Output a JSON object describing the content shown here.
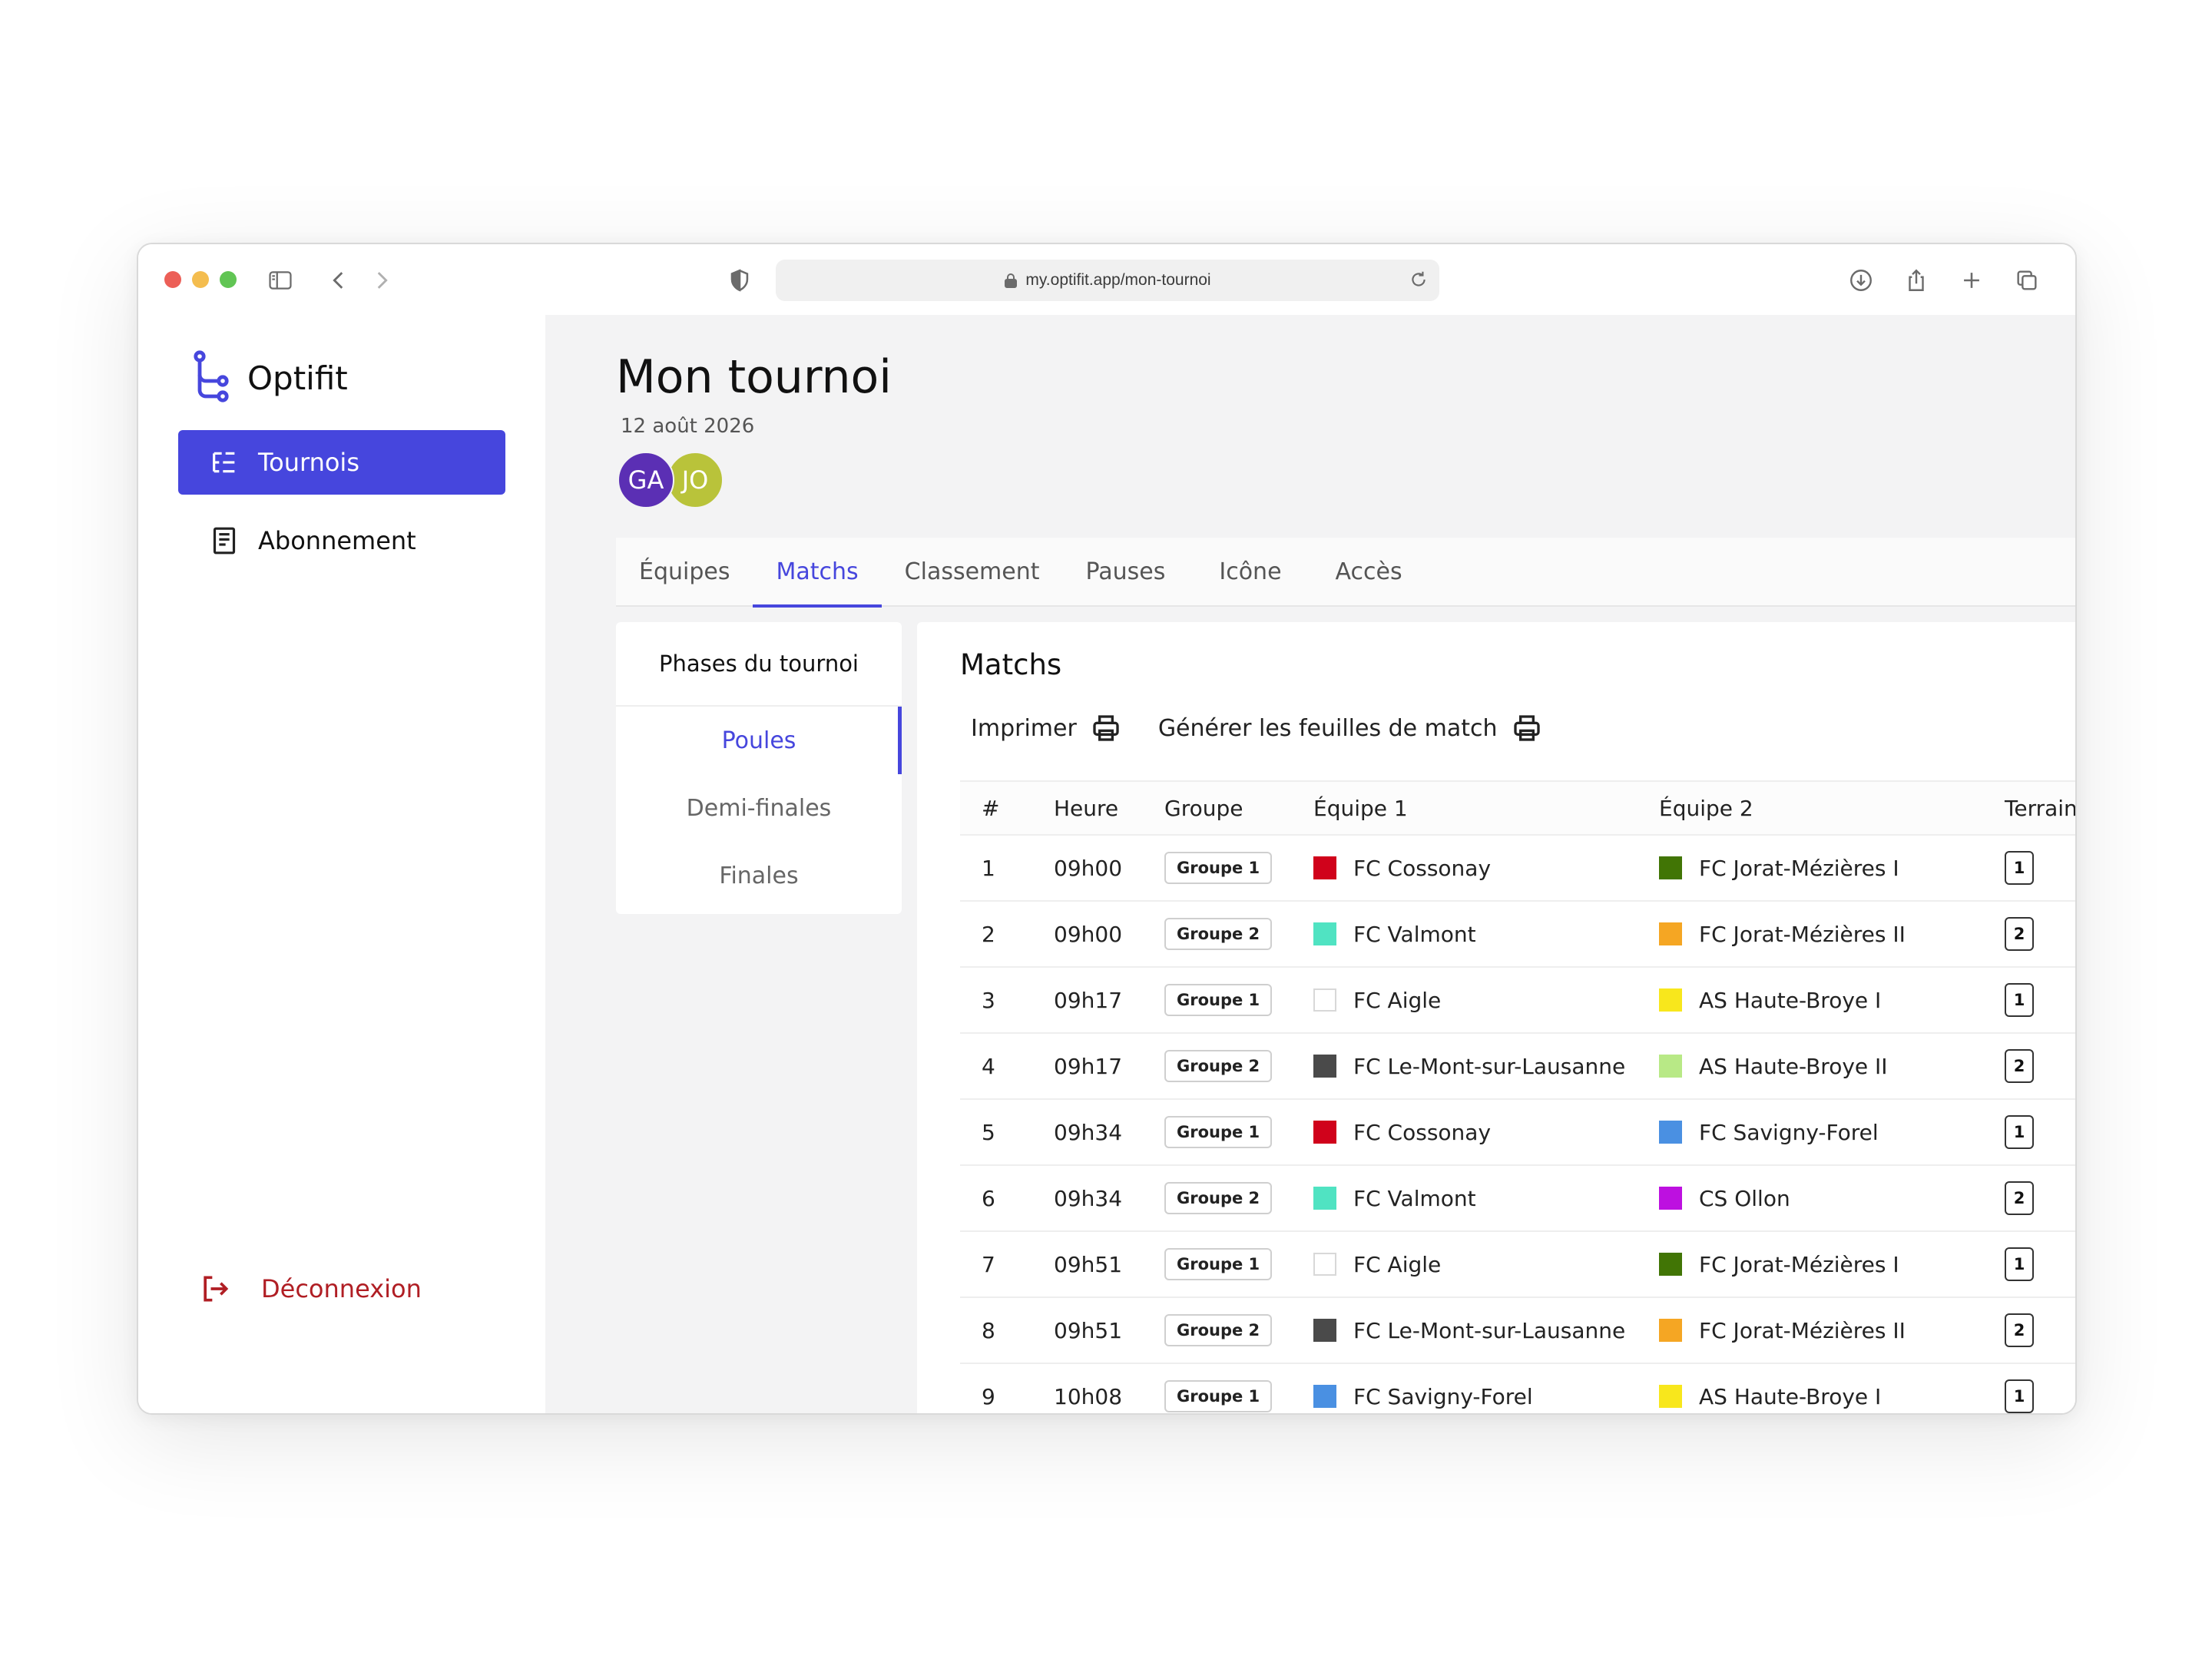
{
  "browser": {
    "url": "my.optifit.app/mon-tournoi"
  },
  "sidebar": {
    "brand": "Optifit",
    "items": [
      {
        "label": "Tournois",
        "icon": "list-tree-icon",
        "active": true
      },
      {
        "label": "Abonnement",
        "icon": "receipt-icon",
        "active": false
      }
    ],
    "logout_label": "Déconnexion"
  },
  "page": {
    "title": "Mon tournoi",
    "date": "12 août 2026",
    "avatars": [
      {
        "initials": "GA",
        "color": "#5b2fb4"
      },
      {
        "initials": "JO",
        "color": "#b9c33a"
      }
    ]
  },
  "tabs": [
    {
      "label": "Équipes",
      "active": false
    },
    {
      "label": "Matchs",
      "active": true
    },
    {
      "label": "Classement",
      "active": false
    },
    {
      "label": "Pauses",
      "active": false
    },
    {
      "label": "Icône",
      "active": false
    },
    {
      "label": "Accès",
      "active": false
    }
  ],
  "phases": {
    "title": "Phases du tournoi",
    "items": [
      {
        "label": "Poules",
        "active": true
      },
      {
        "label": "Demi-finales",
        "active": false
      },
      {
        "label": "Finales",
        "active": false
      }
    ]
  },
  "matches": {
    "title": "Matchs",
    "print_label": "Imprimer",
    "generate_label": "Générer les feuilles de match",
    "columns": [
      "#",
      "Heure",
      "Groupe",
      "Équipe 1",
      "Équipe 2",
      "Terrain"
    ],
    "rows": [
      {
        "num": "1",
        "time": "09h00",
        "group": "Groupe 1",
        "team1": "FC Cossonay",
        "team1_color": "#d0021b",
        "team2": "FC Jorat-Mézières I",
        "team2_color": "#417505",
        "field": "1"
      },
      {
        "num": "2",
        "time": "09h00",
        "group": "Groupe 2",
        "team1": "FC Valmont",
        "team1_color": "#50e3c2",
        "team2": "FC Jorat-Mézières II",
        "team2_color": "#f5a623",
        "field": "2"
      },
      {
        "num": "3",
        "time": "09h17",
        "group": "Groupe 1",
        "team1": "FC Aigle",
        "team1_color": "#ffffff",
        "team2": "AS Haute-Broye I",
        "team2_color": "#f8e71c",
        "field": "1"
      },
      {
        "num": "4",
        "time": "09h17",
        "group": "Groupe 2",
        "team1": "FC Le-Mont-sur-Lausanne",
        "team1_color": "#4a4a4a",
        "team2": "AS Haute-Broye II",
        "team2_color": "#b8e986",
        "field": "2"
      },
      {
        "num": "5",
        "time": "09h34",
        "group": "Groupe 1",
        "team1": "FC Cossonay",
        "team1_color": "#d0021b",
        "team2": "FC Savigny-Forel",
        "team2_color": "#4a90e2",
        "field": "1"
      },
      {
        "num": "6",
        "time": "09h34",
        "group": "Groupe 2",
        "team1": "FC Valmont",
        "team1_color": "#50e3c2",
        "team2": "CS Ollon",
        "team2_color": "#bd10e0",
        "field": "2"
      },
      {
        "num": "7",
        "time": "09h51",
        "group": "Groupe 1",
        "team1": "FC Aigle",
        "team1_color": "#ffffff",
        "team2": "FC Jorat-Mézières I",
        "team2_color": "#417505",
        "field": "1"
      },
      {
        "num": "8",
        "time": "09h51",
        "group": "Groupe 2",
        "team1": "FC Le-Mont-sur-Lausanne",
        "team1_color": "#4a4a4a",
        "team2": "FC Jorat-Mézières II",
        "team2_color": "#f5a623",
        "field": "2"
      },
      {
        "num": "9",
        "time": "10h08",
        "group": "Groupe 1",
        "team1": "FC Savigny-Forel",
        "team1_color": "#4a90e2",
        "team2": "AS Haute-Broye I",
        "team2_color": "#f8e71c",
        "field": "1"
      }
    ]
  }
}
